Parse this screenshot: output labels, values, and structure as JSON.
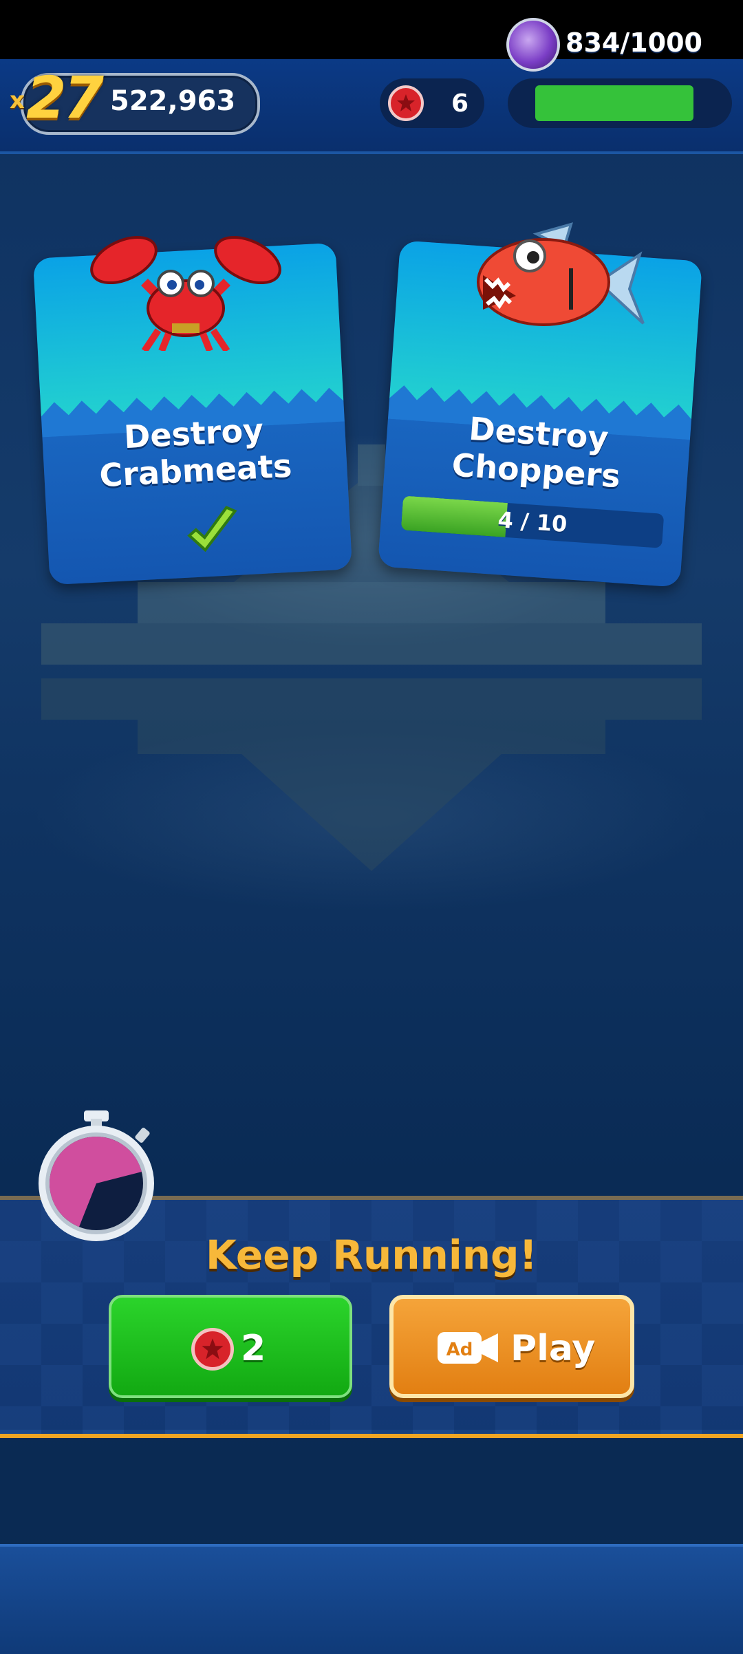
{
  "hud": {
    "multiplier_prefix": "x",
    "multiplier": "27",
    "score": "522,963",
    "red_star_rings": "6",
    "energy_text": "834/1000",
    "energy_fraction": 0.834
  },
  "missions": [
    {
      "title_line1": "Destroy",
      "title_line2": "Crabmeats",
      "completed": true
    },
    {
      "title_line1": "Destroy",
      "title_line2": "Choppers",
      "progress_text": "4 / 10",
      "progress_fraction": 0.4
    }
  ],
  "continue_panel": {
    "title": "Keep Running!",
    "ring_cost": "2",
    "ad_icon": "Ad",
    "play_label": "Play",
    "timer_remaining_fraction": 0.35
  },
  "colors": {
    "accent_orange": "#f0a623",
    "green_button": "#12a912",
    "orange_button": "#e27f12",
    "ring_red": "#d8232a"
  }
}
